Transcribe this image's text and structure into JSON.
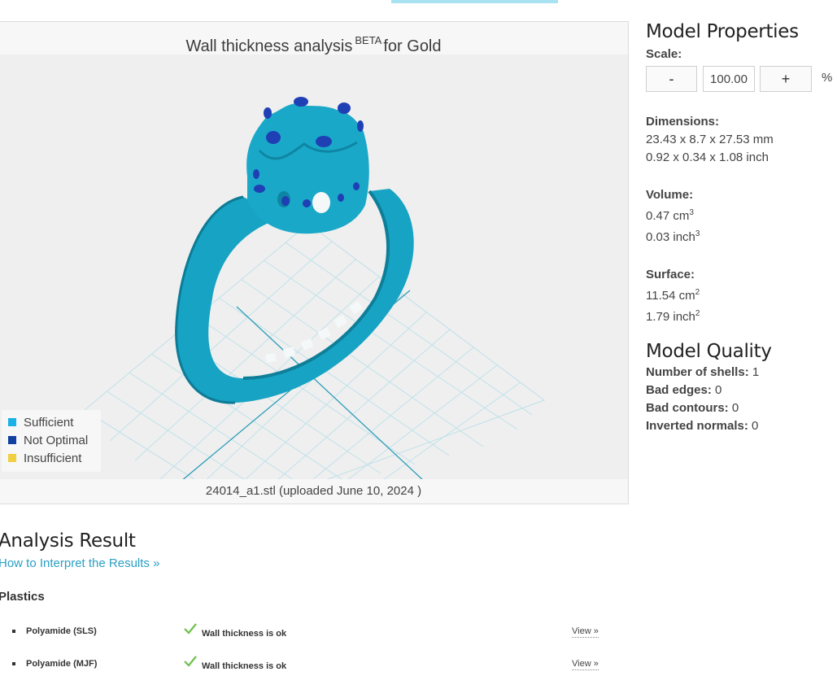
{
  "viewer": {
    "title_prefix": "Wall thickness analysis",
    "title_beta": "BETA",
    "title_suffix": "for Gold",
    "footer": "24014_a1.stl (uploaded June 10, 2024 )",
    "legend": [
      {
        "label": "Sufficient",
        "color": "#1ab2e6"
      },
      {
        "label": "Not Optimal",
        "color": "#1040a0"
      },
      {
        "label": "Insufficient",
        "color": "#f0cf40"
      }
    ]
  },
  "properties": {
    "title": "Model Properties",
    "scale_label": "Scale:",
    "scale_minus": "-",
    "scale_value": "100.00",
    "scale_plus": "+",
    "scale_unit": "%",
    "dimensions_label": "Dimensions:",
    "dimensions_mm": "23.43 x 8.7 x 27.53 mm",
    "dimensions_inch": "0.92 x 0.34 x 1.08 inch",
    "volume_label": "Volume:",
    "volume_cm": "0.47 cm",
    "volume_inch": "0.03 inch",
    "surface_label": "Surface:",
    "surface_cm": "11.54 cm",
    "surface_inch": "1.79 inch",
    "exp3": "3",
    "exp2": "2"
  },
  "quality": {
    "title": "Model Quality",
    "shells_label": "Number of shells:",
    "shells_value": "1",
    "bad_edges_label": "Bad edges:",
    "bad_edges_value": "0",
    "bad_contours_label": "Bad contours:",
    "bad_contours_value": "0",
    "inverted_label": "Inverted normals:",
    "inverted_value": "0"
  },
  "analysis": {
    "title": "Analysis Result",
    "interpret_link": "How to Interpret the Results »",
    "plastics_heading": "Plastics",
    "rows": [
      {
        "material": "Polyamide (SLS)",
        "status": "Wall thickness is ok",
        "view": "View »"
      },
      {
        "material": "Polyamide (MJF)",
        "status": "Wall thickness is ok",
        "view": "View »"
      }
    ]
  }
}
